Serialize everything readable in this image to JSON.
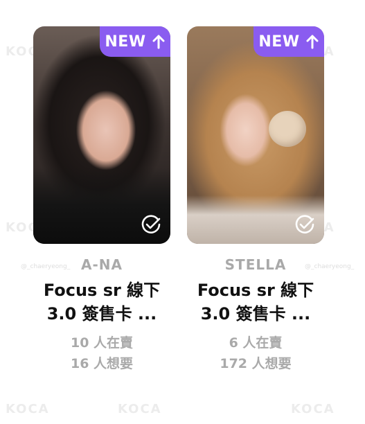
{
  "watermark": {
    "brand": "KOCA",
    "handle": "@_chaeryeong_"
  },
  "cards": [
    {
      "badge": "NEW",
      "artist": "A-NA",
      "title": "Focus sr 線下\n3.0 簽售卡 ...",
      "sellers": "10 人在賣",
      "wanters": "16 人想要"
    },
    {
      "badge": "NEW",
      "artist": "STELLA",
      "title": "Focus sr 線下\n3.0 簽售卡 ...",
      "sellers": "6 人在賣",
      "wanters": "172 人想要"
    }
  ],
  "colors": {
    "accent": "#8a5cf0",
    "muted": "#a9a9a9",
    "text": "#111111"
  },
  "icons": {
    "badge_icon": "arrow-up-icon",
    "owned_icon": "check-circle-icon"
  }
}
